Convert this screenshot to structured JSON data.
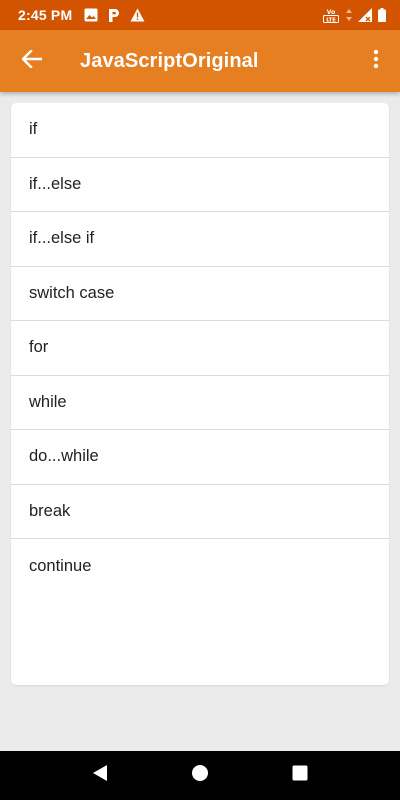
{
  "status_bar": {
    "time": "2:45 PM",
    "left_icons": [
      "image-icon",
      "parking-icon",
      "warning-icon"
    ],
    "right_icons": [
      "volte-icon",
      "signal-icon",
      "battery-icon"
    ],
    "volte_label": "VoLTE"
  },
  "app_bar": {
    "title": "JavaScriptOriginal",
    "back_icon": "arrow-left-icon",
    "menu_icon": "more-vertical-icon"
  },
  "list": {
    "items": [
      "if",
      "if...else",
      "if...else if",
      "switch case",
      "for",
      "while",
      "do...while",
      "break",
      "continue"
    ]
  },
  "nav_bar": {
    "buttons": [
      "back-triangle-icon",
      "home-circle-icon",
      "recents-square-icon"
    ]
  },
  "colors": {
    "status_bar": "#d35400",
    "app_bar": "#e67e22",
    "background": "#ebebeb",
    "card": "#ffffff",
    "nav_bar": "#000000"
  }
}
